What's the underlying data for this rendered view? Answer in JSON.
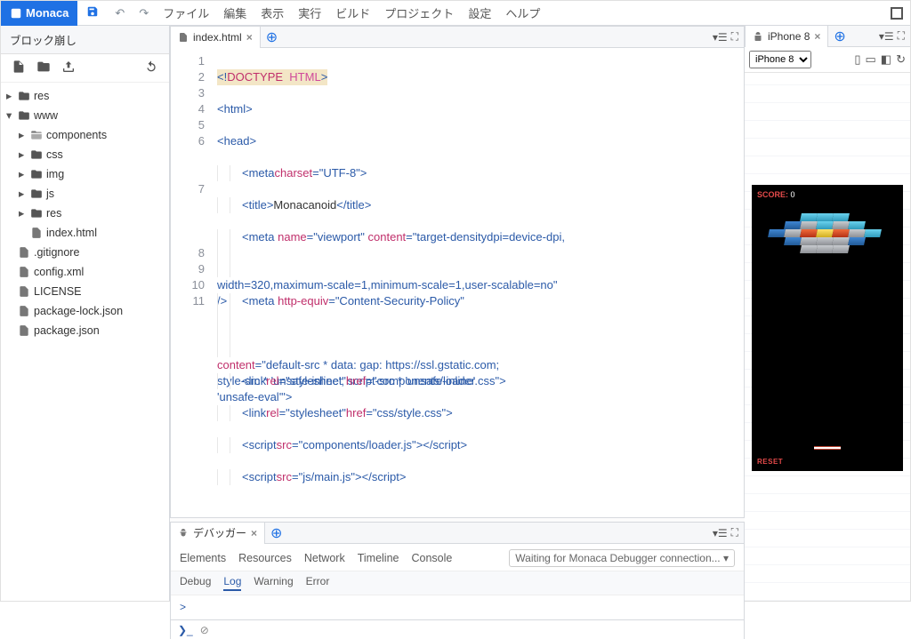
{
  "brand": "Monaca",
  "menus": [
    "ファイル",
    "編集",
    "表示",
    "実行",
    "ビルド",
    "プロジェクト",
    "設定",
    "ヘルプ"
  ],
  "sidebar_title": "ブロック崩し",
  "tree": {
    "res": "res",
    "www": "www",
    "components": "components",
    "css": "css",
    "img": "img",
    "js": "js",
    "res2": "res",
    "indexhtml": "index.html",
    "gitignore": ".gitignore",
    "configxml": "config.xml",
    "license": "LICENSE",
    "pkg_lock": "package-lock.json",
    "pkg": "package.json"
  },
  "editor_tab": "index.html",
  "editor_lines": {
    "l1_a": "<!",
    "l1_b": "DOCTYPE",
    "l1_c": "HTML",
    "l1_d": ">",
    "l2": "html",
    "l3": "head",
    "l4_attr": "charset",
    "l4_val": "\"UTF-8\"",
    "l5_tag": "title",
    "l5_txt": "Monacanoid",
    "l6_a1": "name",
    "l6_v1": "\"viewport\"",
    "l6_a2": "content",
    "l6_v2": "\"target-densitydpi=device-dpi,\nwidth=320,maximum-scale=1,minimum-scale=1,user-scalable=no\"",
    "l7_a1": "http-equiv",
    "l7_v1": "\"Content-Security-Policy\"",
    "l7_a2": "content",
    "l7_v2": "\"default-src * data: gap: https://ssl.gstatic.com;\nstyle-src * 'unsafe-inline'; script-src * 'unsafe-inline'\n'unsafe-eval'\"",
    "l8_a1": "rel",
    "l8_v1": "\"stylesheet\"",
    "l8_a2": "href",
    "l8_v2": "\"components/loader.css\"",
    "l9_a1": "rel",
    "l9_v1": "\"stylesheet\"",
    "l9_a2": "href",
    "l9_v2": "\"css/style.css\"",
    "l10_a1": "src",
    "l10_v1": "\"components/loader.js\"",
    "l11_a1": "src",
    "l11_v1": "\"js/main.js\"",
    "meta": "meta",
    "link": "link",
    "script": "script"
  },
  "line_numbers": [
    "1",
    "2",
    "3",
    "4",
    "5",
    "6",
    "7",
    "8",
    "9",
    "10",
    "11"
  ],
  "debugger": {
    "title": "デバッガー",
    "tabs": [
      "Elements",
      "Resources",
      "Network",
      "Timeline",
      "Console"
    ],
    "subtabs": [
      "Debug",
      "Log",
      "Warning",
      "Error"
    ],
    "status": "Waiting for Monaca Debugger connection...",
    "prompt": ">"
  },
  "preview": {
    "device_tab": "iPhone 8",
    "device_option": "iPhone 8",
    "score_label": "SCORE:",
    "score_value": "0",
    "reset": "RESET"
  }
}
